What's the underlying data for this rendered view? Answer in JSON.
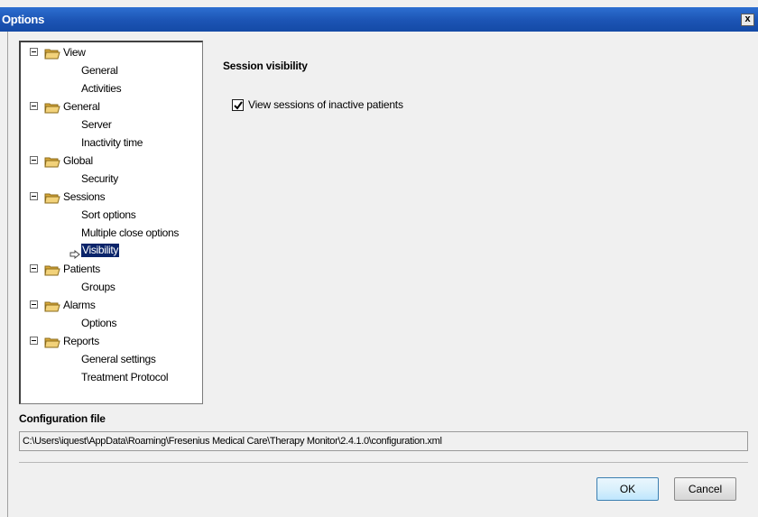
{
  "window": {
    "title": "Options",
    "close_glyph": "x"
  },
  "tree": {
    "groups": [
      {
        "label": "View",
        "children": [
          "General",
          "Activities"
        ]
      },
      {
        "label": "General",
        "children": [
          "Server",
          "Inactivity time"
        ]
      },
      {
        "label": "Global",
        "children": [
          "Security"
        ]
      },
      {
        "label": "Sessions",
        "children": [
          "Sort options",
          "Multiple close options",
          "Visibility"
        ]
      },
      {
        "label": "Patients",
        "children": [
          "Groups"
        ]
      },
      {
        "label": "Alarms",
        "children": [
          "Options"
        ]
      },
      {
        "label": "Reports",
        "children": [
          "General settings",
          "Treatment Protocol"
        ]
      }
    ],
    "selected": "Visibility"
  },
  "panel": {
    "section_title": "Session visibility",
    "checkbox_label": "View sessions of inactive patients",
    "checkbox_checked": true
  },
  "config": {
    "title": "Configuration file",
    "path": "C:\\Users\\iquest\\AppData\\Roaming\\Fresenius Medical Care\\Therapy Monitor\\2.4.1.0\\configuration.xml"
  },
  "buttons": {
    "ok": "OK",
    "cancel": "Cancel"
  },
  "colors": {
    "titlebar": "#1c54b4",
    "selection": "#0a246a",
    "folder": "#e8c25a"
  },
  "icons": {
    "folder": "folder-icon",
    "expander": "collapse-icon",
    "arrow": "arrow-right-icon",
    "check": "checkmark-icon"
  }
}
